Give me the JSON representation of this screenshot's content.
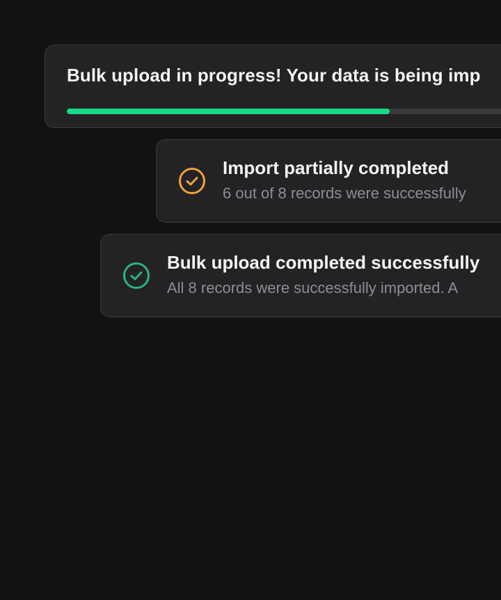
{
  "toasts": {
    "progress": {
      "message": "Bulk upload in progress! Your data is being imp",
      "progress_fraction": 0.7,
      "color": "#16d987"
    },
    "partial": {
      "title": "Import partially completed",
      "description": "6 out of 8 records were successfully",
      "icon": "check-circle-icon",
      "color": "#f0a33a"
    },
    "success": {
      "title": "Bulk upload completed successfully",
      "description": "All 8 records were successfully imported. A",
      "icon": "check-circle-icon",
      "color": "#2ab386"
    }
  }
}
